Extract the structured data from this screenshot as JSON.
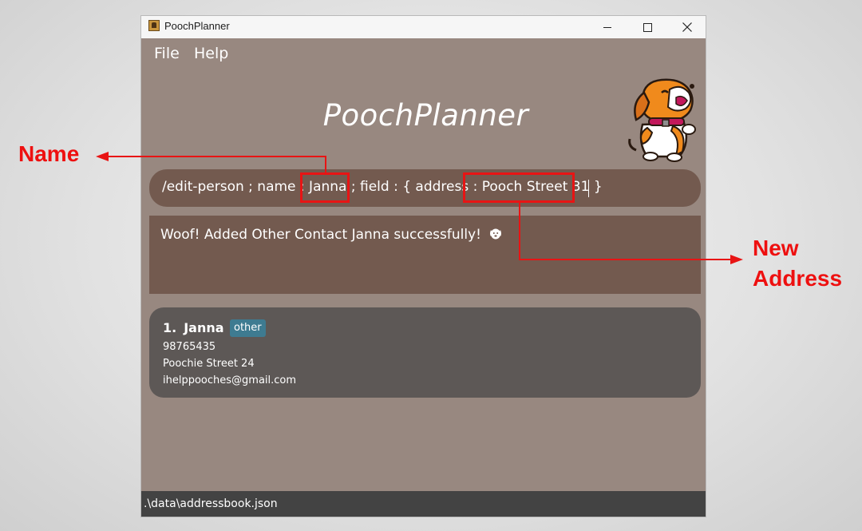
{
  "window": {
    "title": "PoochPlanner"
  },
  "menu": {
    "file": "File",
    "help": "Help"
  },
  "heading": "PoochPlanner",
  "command": {
    "value": "/edit-person ; name : Janna ; field : { address : Pooch Street 31 }"
  },
  "result": {
    "message": "Woof! Added Other Contact Janna successfully!",
    "icon": "dog-face-icon"
  },
  "contacts": [
    {
      "index": "1.",
      "name": "Janna",
      "tag": "other",
      "phone": "98765435",
      "address": "Poochie Street 24",
      "email": "ihelppooches@gmail.com"
    }
  ],
  "status": {
    "path": ".\\data\\addressbook.json"
  },
  "annotations": {
    "name_label": "Name",
    "address_label_line1": "New",
    "address_label_line2": "Address",
    "color": "#ee1010"
  },
  "colors": {
    "window_bg": "#988880",
    "command_bg": "#735a4f",
    "card_bg": "#5d5856",
    "tag_bg": "#3e7b91",
    "statusbar_bg": "#434343"
  }
}
